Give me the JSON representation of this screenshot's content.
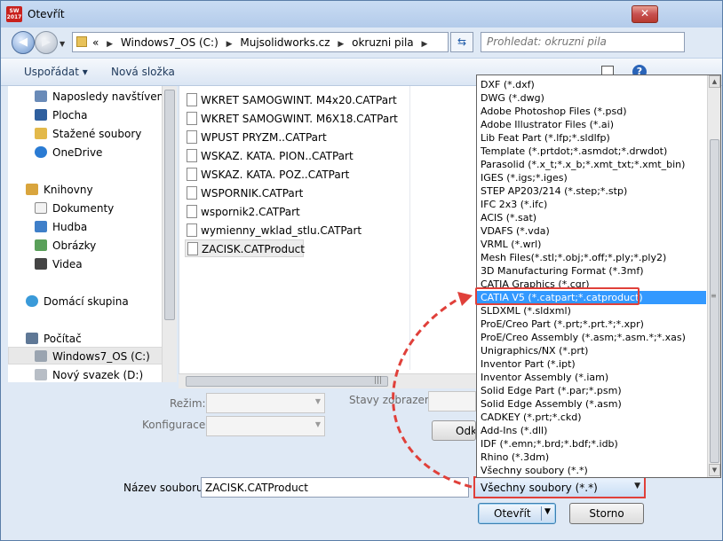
{
  "window": {
    "title": "Otevřít",
    "app_icon_text": "SW 2017",
    "close_symbol": "✕"
  },
  "nav": {
    "address_breadcrumbs": [
      "Windows7_OS (C:)",
      "Mujsolidworks.cz",
      "okruzni pila"
    ],
    "overflow_symbol": "«",
    "search_placeholder": "Prohledat: okruzni pila"
  },
  "toolbar": {
    "organize_label": "Uspořádat",
    "new_folder_label": "Nová složka"
  },
  "sidebar": {
    "items": [
      {
        "label": "Naposledy navštívené",
        "icon": "recent-places-icon"
      },
      {
        "label": "Plocha",
        "icon": "desktop-icon"
      },
      {
        "label": "Stažené soubory",
        "icon": "downloads-folder-icon"
      },
      {
        "label": "OneDrive",
        "icon": "cloud-icon"
      },
      {
        "label": "Knihovny",
        "icon": "libraries-icon"
      },
      {
        "label": "Dokumenty",
        "icon": "documents-icon"
      },
      {
        "label": "Hudba",
        "icon": "music-icon"
      },
      {
        "label": "Obrázky",
        "icon": "pictures-icon"
      },
      {
        "label": "Videa",
        "icon": "videos-icon"
      },
      {
        "label": "Domácí skupina",
        "icon": "homegroup-icon"
      },
      {
        "label": "Počítač",
        "icon": "computer-icon"
      },
      {
        "label": "Windows7_OS (C:)",
        "icon": "drive-icon"
      },
      {
        "label": "Nový svazek (D:)",
        "icon": "drive-icon"
      }
    ]
  },
  "files": [
    "WKRET SAMOGWINT. M4x20.CATPart",
    "WKRET SAMOGWINT. M6X18.CATPart",
    "WPUST PRYZM..CATPart",
    "WSKAZ. KATA. PION..CATPart",
    "WSKAZ. KATA. POZ..CATPart",
    "WSPORNIK.CATPart",
    "wspornik2.CATPart",
    "wymienny_wklad_stlu.CATPart",
    "ZACISK.CATProduct"
  ],
  "form": {
    "mode_label": "Režim:",
    "config_label": "Konfigurace:",
    "display_states_label": "Stavy zobrazení:",
    "references_button": "Odkazy...",
    "filename_label": "Název souboru:",
    "filename_value": "ZACISK.CATProduct",
    "filetype_value": "Všechny soubory (*.*)",
    "open_button": "Otevřít",
    "cancel_button": "Storno"
  },
  "filetype_options": [
    "DXF (*.dxf)",
    "DWG (*.dwg)",
    "Adobe Photoshop Files (*.psd)",
    "Adobe Illustrator Files (*.ai)",
    "Lib Feat Part (*.lfp;*.sldlfp)",
    "Template (*.prtdot;*.asmdot;*.drwdot)",
    "Parasolid (*.x_t;*.x_b;*.xmt_txt;*.xmt_bin)",
    "IGES (*.igs;*.iges)",
    "STEP AP203/214 (*.step;*.stp)",
    "IFC 2x3 (*.ifc)",
    "ACIS (*.sat)",
    "VDAFS (*.vda)",
    "VRML (*.wrl)",
    "Mesh Files(*.stl;*.obj;*.off;*.ply;*.ply2)",
    "3D Manufacturing Format (*.3mf)",
    "CATIA Graphics (*.cgr)",
    "CATIA V5 (*.catpart;*.catproduct)",
    "SLDXML (*.sldxml)",
    "ProE/Creo Part (*.prt;*.prt.*;*.xpr)",
    "ProE/Creo Assembly (*.asm;*.asm.*;*.xas)",
    "Unigraphics/NX (*.prt)",
    "Inventor Part (*.ipt)",
    "Inventor Assembly (*.iam)",
    "Solid Edge Part (*.par;*.psm)",
    "Solid Edge Assembly (*.asm)",
    "CADKEY (*.prt;*.ckd)",
    "Add-Ins (*.dll)",
    "IDF (*.emn;*.brd;*.bdf;*.idb)",
    "Rhino (*.3dm)",
    "Všechny soubory (*.*)"
  ],
  "selected_filetype": "CATIA V5 (*.catpart;*.catproduct)",
  "colors": {
    "selection": "#3399ff",
    "annotation_red": "#e0403a"
  }
}
